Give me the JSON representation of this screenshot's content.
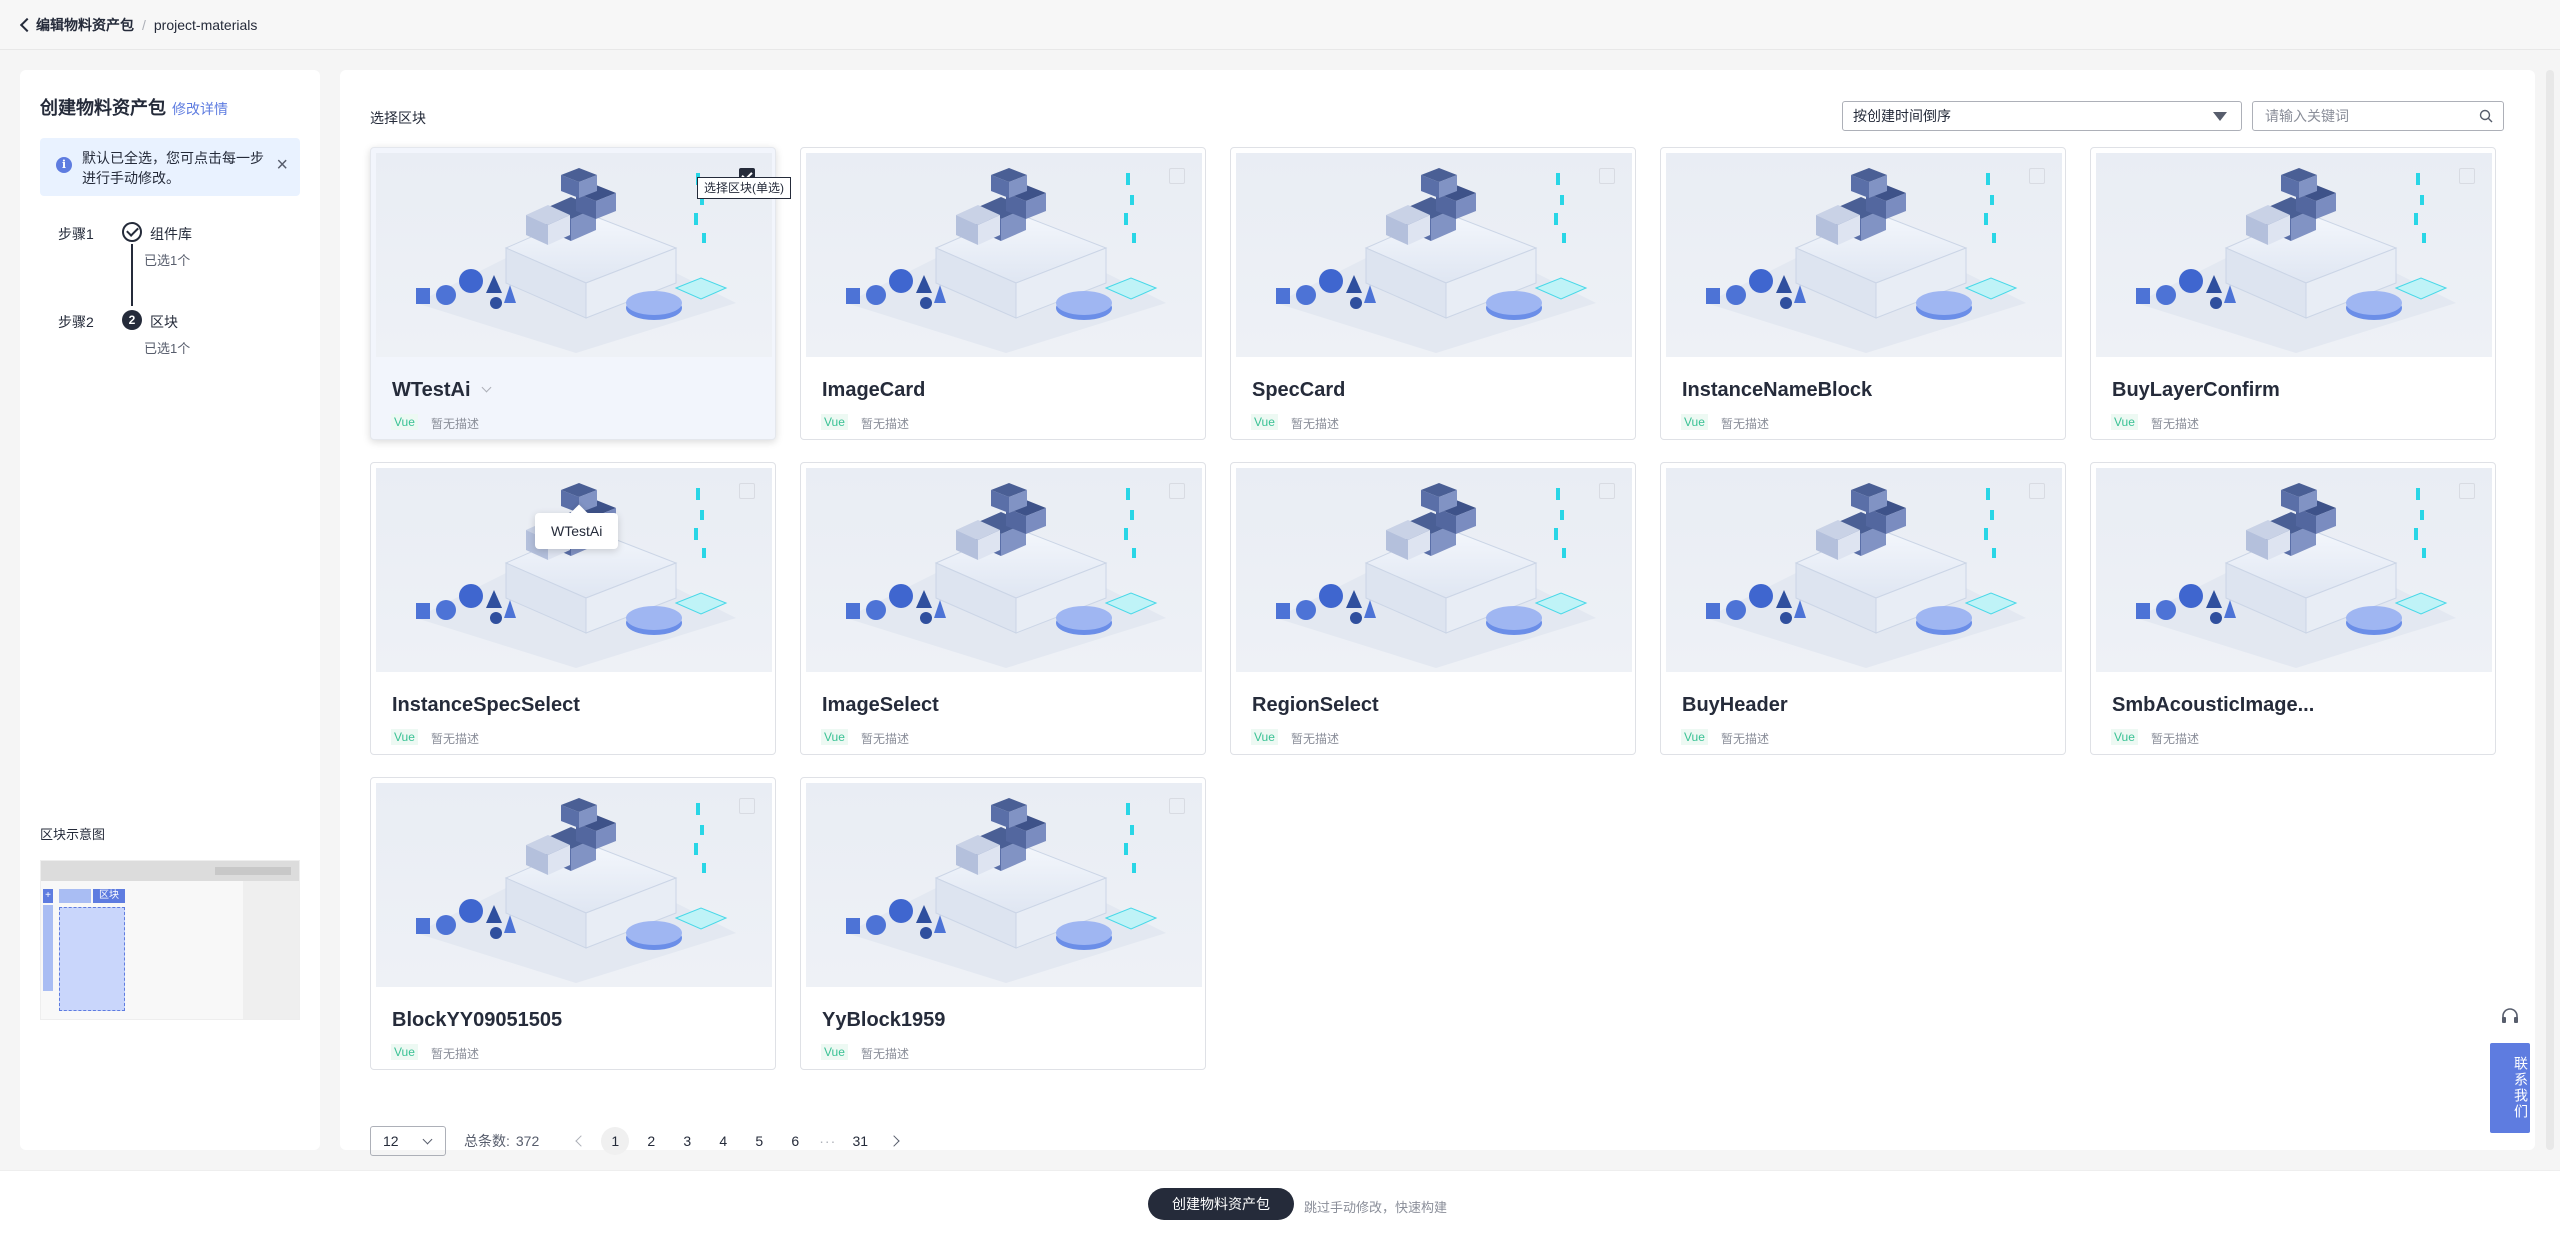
{
  "breadcrumb": {
    "back_label": "编辑物料资产包",
    "current": "project-materials"
  },
  "sidebar": {
    "title": "创建物料资产包",
    "edit_link": "修改详情",
    "alert": "默认已全选，您可点击每一步进行手动修改。",
    "steps": [
      {
        "label": "步骤1",
        "name": "组件库",
        "sub": "已选1个",
        "status": "done"
      },
      {
        "label": "步骤2",
        "number": "2",
        "name": "区块",
        "sub": "已选1个",
        "status": "active"
      }
    ],
    "preview_label": "区块示意图",
    "preview_tab": "区块",
    "preview_plus": "+"
  },
  "main": {
    "title": "选择区块",
    "sort_value": "按创建时间倒序",
    "search_placeholder": "请输入关键词",
    "tooltip_select": "选择区块(单选)",
    "tooltip_name": "WTestAi",
    "cards": [
      {
        "name": "WTestAi",
        "tag": "Vue",
        "desc": "暂无描述",
        "selected": true
      },
      {
        "name": "ImageCard",
        "tag": "Vue",
        "desc": "暂无描述",
        "selected": false
      },
      {
        "name": "SpecCard",
        "tag": "Vue",
        "desc": "暂无描述",
        "selected": false
      },
      {
        "name": "InstanceNameBlock",
        "tag": "Vue",
        "desc": "暂无描述",
        "selected": false
      },
      {
        "name": "BuyLayerConfirm",
        "tag": "Vue",
        "desc": "暂无描述",
        "selected": false
      },
      {
        "name": "InstanceSpecSelect",
        "tag": "Vue",
        "desc": "暂无描述",
        "selected": false
      },
      {
        "name": "ImageSelect",
        "tag": "Vue",
        "desc": "暂无描述",
        "selected": false
      },
      {
        "name": "RegionSelect",
        "tag": "Vue",
        "desc": "暂无描述",
        "selected": false
      },
      {
        "name": "BuyHeader",
        "tag": "Vue",
        "desc": "暂无描述",
        "selected": false
      },
      {
        "name": "SmbAcousticImage...",
        "tag": "Vue",
        "desc": "暂无描述",
        "selected": false
      },
      {
        "name": "BlockYY09051505",
        "tag": "Vue",
        "desc": "暂无描述",
        "selected": false
      },
      {
        "name": "YyBlock1959",
        "tag": "Vue",
        "desc": "暂无描述",
        "selected": false
      }
    ]
  },
  "pagination": {
    "page_size": "12",
    "total_label": "总条数:",
    "total": "372",
    "pages": [
      "1",
      "2",
      "3",
      "4",
      "5",
      "6"
    ],
    "ellipsis": "···",
    "last_page": "31",
    "current": "1"
  },
  "footer": {
    "create_button": "创建物料资产包",
    "skip_text": "跳过手动修改，快速构建"
  },
  "contact": {
    "label": "联系我们"
  },
  "colors": {
    "primary": "#252b3a",
    "accent": "#5e7ce0",
    "tag_green": "#3ac295"
  }
}
